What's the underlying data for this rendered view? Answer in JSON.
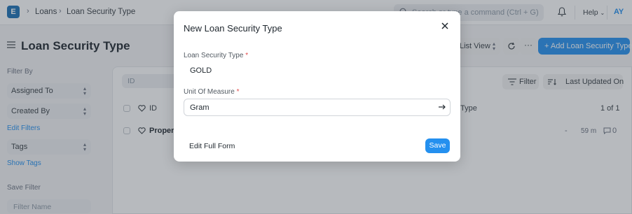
{
  "navbar": {
    "logo_letter": "E",
    "breadcrumbs": [
      "Loans",
      "Loan Security Type"
    ],
    "search_placeholder": "Search or type a command (Ctrl + G)",
    "help_label": "Help",
    "avatar_initials": "AY"
  },
  "page": {
    "title": "Loan Security Type",
    "list_view_label": "List View",
    "add_button_label": "+ Add Loan Security Type"
  },
  "sidebar": {
    "filter_by_label": "Filter By",
    "assigned_to_label": "Assigned To",
    "created_by_label": "Created By",
    "edit_filters_label": "Edit Filters",
    "tags_label": "Tags",
    "show_tags_label": "Show Tags",
    "save_filter_label": "Save Filter",
    "filter_name_placeholder": "Filter Name"
  },
  "list": {
    "id_filter_placeholder": "ID",
    "filter_button_label": "Filter",
    "sort_by_label": "Last Updated On",
    "header": {
      "id_col": "ID",
      "type_col": "Type",
      "count": "1 of 1"
    },
    "rows": [
      {
        "name": "Propert",
        "dash": "-",
        "modified": "59 m",
        "comments": "0"
      }
    ]
  },
  "modal": {
    "title": "New Loan Security Type",
    "field1_label": "Loan Security Type",
    "field1_value": "GOLD",
    "field2_label": "Unit Of Measure",
    "field2_value": "Gram",
    "required_mark": "*",
    "edit_full_form_label": "Edit Full Form",
    "save_label": "Save"
  },
  "colors": {
    "primary": "#2490ef",
    "required": "#e24c4c",
    "logo": "#1a6fb5"
  }
}
